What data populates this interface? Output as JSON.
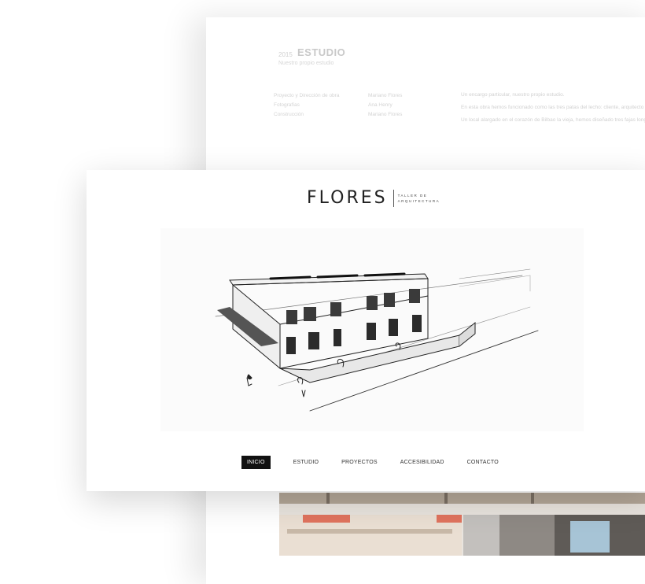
{
  "back_page": {
    "section_tag": "2015",
    "title": "ESTUDIO",
    "subtitle": "Nuestro propio estudio",
    "credits": [
      {
        "key": "Proyecto y Dirección de obra",
        "value": "Mariano Flores"
      },
      {
        "key": "Fotografías",
        "value": "Ana Henry"
      },
      {
        "key": "Construcción",
        "value": "Mariano Flores"
      }
    ],
    "paragraphs": [
      "Un encargo particular, nuestro propio estudio.",
      "En esta obra hemos funcionado como las tres patas del lecho: cliente, arquitecto y constructor.",
      "Un local alargado en el corazón de Bilbao la vieja, hemos diseñado tres fajas longitudinales, puestos de trabajo, circulación y almacenaje. Se ha aprovechado una pared de piedra y ladrillo que hemos pintado de neutro para uniformizar sus distintos acabados."
    ]
  },
  "brand": {
    "name": "FLORES",
    "tagline_line1": "TALLER DE",
    "tagline_line2": "ARQUITECTURA"
  },
  "nav": {
    "items": [
      "INICIO",
      "ESTUDIO",
      "PROYECTOS",
      "ACCESIBILIDAD",
      "CONTACTO"
    ],
    "active_index": 0
  },
  "colors": {
    "background": "#ffffff",
    "active_nav_bg": "#111111",
    "text_dark": "#222222"
  }
}
